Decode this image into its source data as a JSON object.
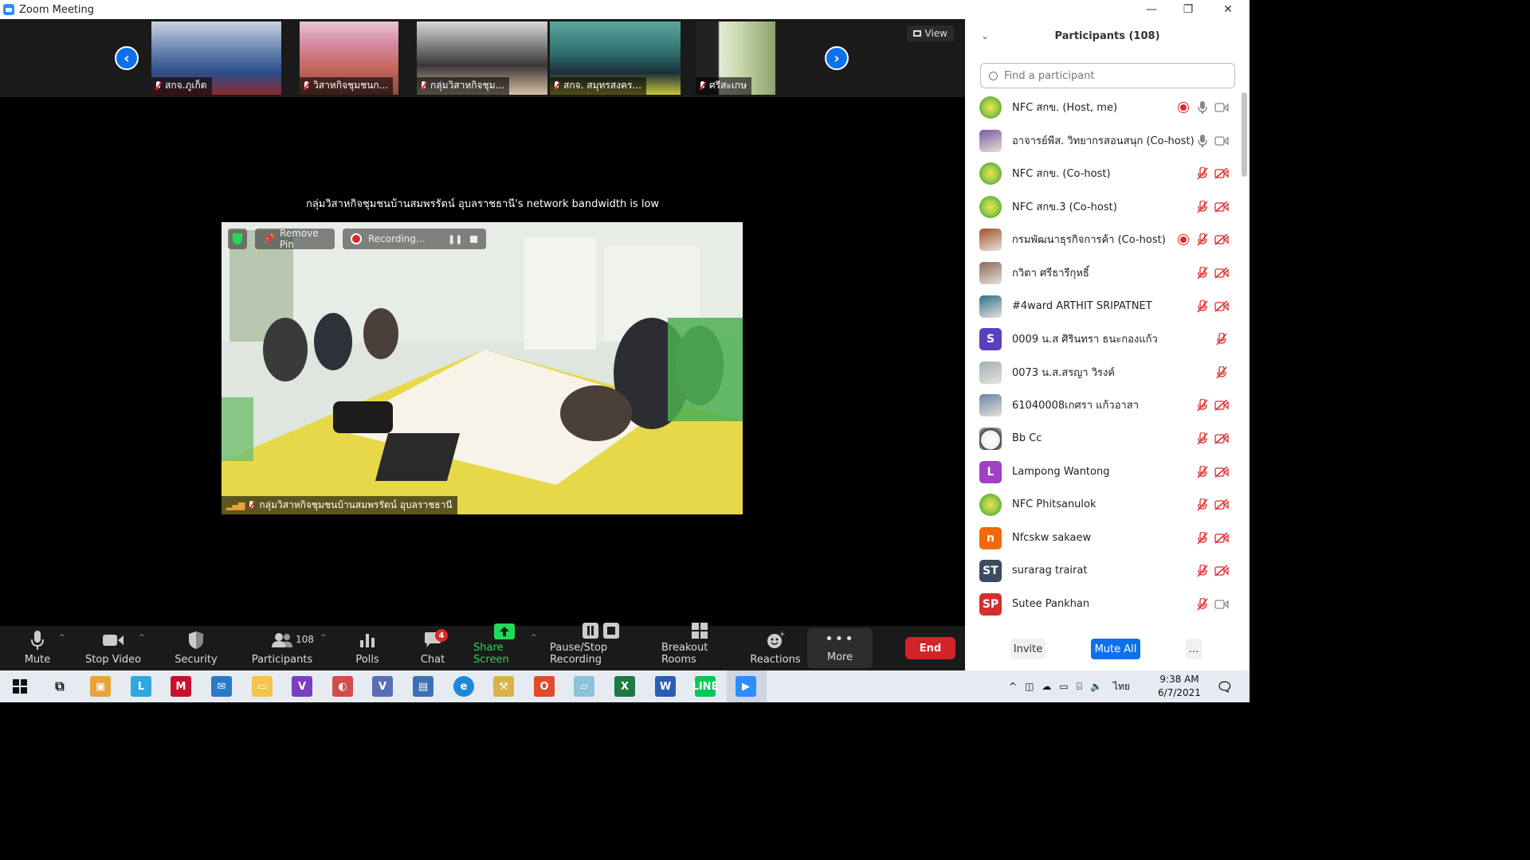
{
  "window": {
    "title": "Zoom Meeting"
  },
  "thumbnails": [
    {
      "name": "สกจ.ภูเก็ต"
    },
    {
      "name": "วิสาหกิจชุมชนก..."
    },
    {
      "name": "กลุ่มวิสาหกิจชุม..."
    },
    {
      "name": "สกจ. สมุทรสงคร..."
    },
    {
      "name": "ศรีสะเกษ"
    }
  ],
  "view_label": "View",
  "warning": "กลุ่มวิสาหกิจชุมชนบ้านสมพรรัตน์ อุบลราชธานี's network bandwidth is low",
  "main_video": {
    "remove_pin": "Remove Pin",
    "recording": "Recording...",
    "name": "กลุ่มวิสาหกิจชุมชนบ้านสมพรรัตน์ อุบลราชธานี"
  },
  "toolbar": {
    "mute": "Mute",
    "stop_video": "Stop Video",
    "security": "Security",
    "participants": "Participants",
    "participants_count": "108",
    "polls": "Polls",
    "chat": "Chat",
    "chat_badge": "4",
    "share_screen": "Share Screen",
    "pause_recording": "Pause/Stop Recording",
    "breakout": "Breakout Rooms",
    "reactions": "Reactions",
    "more": "More",
    "end": "End"
  },
  "panel": {
    "title": "Participants (108)",
    "search_placeholder": "Find a participant",
    "invite": "Invite",
    "mute_all": "Mute All",
    "more": "...",
    "participants": [
      {
        "name": "NFC สกข. (Host, me)",
        "avatar_type": "logo",
        "recording": true,
        "mic": "on",
        "video": "on"
      },
      {
        "name": "อาจารย์พีส. วิทยากรสอนสนุก (Co-host)",
        "avatar_type": "photo",
        "recording": false,
        "mic": "on",
        "video": "on"
      },
      {
        "name": "NFC สกข. (Co-host)",
        "avatar_type": "logo",
        "recording": false,
        "mic": "muted",
        "video": "off"
      },
      {
        "name": "NFC สกข.3 (Co-host)",
        "avatar_type": "logo",
        "recording": false,
        "mic": "muted",
        "video": "off"
      },
      {
        "name": "กรมพัฒนาธุรกิจการค้า (Co-host)",
        "avatar_type": "photo",
        "recording": true,
        "mic": "muted",
        "video": "off"
      },
      {
        "name": " กวิตา ศรีธารีกุหธิ์",
        "avatar_type": "photo",
        "recording": false,
        "mic": "muted",
        "video": "off"
      },
      {
        "name": "#4ward  ARTHIT SRIPATNET",
        "avatar_type": "photo",
        "recording": false,
        "mic": "muted",
        "video": "off"
      },
      {
        "name": "0009 น.ส ศิรินทรา ธนะกองแก้ว",
        "avatar_type": "letter",
        "initials": "S",
        "color": "#5a3fc0",
        "recording": false,
        "mic": "muted",
        "video": "none"
      },
      {
        "name": "0073 น.ส.สรญา  วิรงค์",
        "avatar_type": "photo",
        "recording": false,
        "mic": "muted",
        "video": "none"
      },
      {
        "name": "61040008เกศรา แก้วอาสา",
        "avatar_type": "photo",
        "recording": false,
        "mic": "muted",
        "video": "off"
      },
      {
        "name": "Bb Cc",
        "avatar_type": "cartoon",
        "recording": false,
        "mic": "muted",
        "video": "off"
      },
      {
        "name": "Lampong Wantong",
        "avatar_type": "letter",
        "initials": "L",
        "color": "#a33fc6",
        "recording": false,
        "mic": "muted",
        "video": "off"
      },
      {
        "name": "NFC Phitsanulok",
        "avatar_type": "logo",
        "recording": false,
        "mic": "muted",
        "video": "off"
      },
      {
        "name": "Nfcskw sakaew",
        "avatar_type": "letter",
        "initials": "n",
        "color": "#f06a0a",
        "recording": false,
        "mic": "muted",
        "video": "off"
      },
      {
        "name": "surarag trairat",
        "avatar_type": "letter",
        "initials": "ST",
        "color": "#3b4a5e",
        "recording": false,
        "mic": "muted",
        "video": "off"
      },
      {
        "name": "Sutee Pankhan",
        "avatar_type": "letter",
        "initials": "SP",
        "color": "#d32f2f",
        "recording": false,
        "mic": "muted",
        "video": "on"
      }
    ]
  },
  "taskbar": {
    "lang": "ไทย",
    "time": "9:38 AM",
    "date": "6/7/2021"
  },
  "colors": {
    "accent": "#0e71eb",
    "end": "#d2232a",
    "share": "#23d959",
    "muted": "#e02828"
  }
}
